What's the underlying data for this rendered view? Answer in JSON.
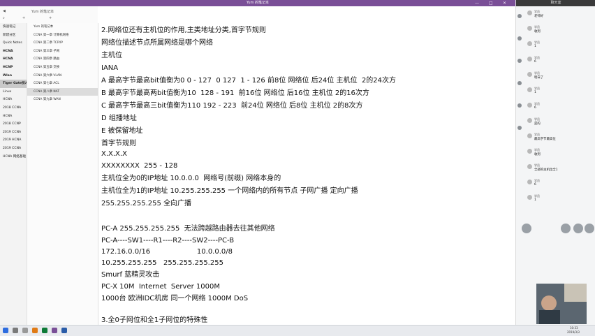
{
  "window": {
    "title": "Yum 的笔记本",
    "controls": [
      "—",
      "□",
      "✕"
    ]
  },
  "toolbar": {
    "notebook_label": "Yum 的笔记本",
    "add_section": "+",
    "add_page": "+"
  },
  "sidebar": {
    "sections": [
      {
        "label": "快速笔记"
      },
      {
        "label": "新建分区"
      },
      {
        "label": "Quick Notes"
      },
      {
        "label": "HCNA"
      },
      {
        "label": "HCNA"
      },
      {
        "label": "HCNP"
      },
      {
        "label": "Wlan"
      },
      {
        "label": "Tiger Gate技术讨论"
      },
      {
        "label": "Linux"
      },
      {
        "label": "HCNA"
      },
      {
        "label": "2018 CCNA"
      },
      {
        "label": "HCNA"
      },
      {
        "label": "2018 CCNP"
      },
      {
        "label": "2019 CCNA"
      },
      {
        "label": "2019 HCNA"
      },
      {
        "label": "2019 CCNA"
      },
      {
        "label": "HCNA 网络基础"
      }
    ],
    "selected_index": 7
  },
  "pages": {
    "items": [
      {
        "label": "Yum 的笔记本"
      },
      {
        "label": "CCNA 第一章 计算机网络"
      },
      {
        "label": "CCNA 第二章 TCP/IP"
      },
      {
        "label": "CCNA 第三章 子网"
      },
      {
        "label": "CCNA 第四章 路由"
      },
      {
        "label": "CCNA 第五章 交换"
      },
      {
        "label": "CCNA 第六章 VLAN"
      },
      {
        "label": "CCNA 第七章 ACL"
      },
      {
        "label": "CCNA 第八章 NAT"
      },
      {
        "label": "CCNA 第九章 WAN"
      }
    ],
    "selected_index": 8
  },
  "content": {
    "lines": [
      {
        "text": "2.网络位还有主机位的作用,主类地址分类,首字节规则"
      },
      {
        "text": "网络位描述节点所属网络是哪个网络"
      },
      {
        "text": "主机位"
      },
      {
        "text": "IANA"
      },
      {
        "text": "A 最高字节最高bit值衡为0 0 - 127  0 127  1 - 126 前8位 网络位 后24位 主机位  2的24次方"
      },
      {
        "text": "B 最高字节最高两bit值衡为10  128 - 191  前16位 网络位 后16位 主机位 2的16次方"
      },
      {
        "text": "C 最高字节最高三bit值衡为110 192 - 223  前24位 网络位 后8位 主机位 2的8次方"
      },
      {
        "text": "D 组播地址"
      },
      {
        "text": "E 被保留地址"
      },
      {
        "text": "首字节规则"
      },
      {
        "text": "X.X.X.X"
      },
      {
        "text": "XXXXXXXX  255 - 128"
      },
      {
        "text": "主机位全为0的IP地址 10.0.0.0  网络号(前缀) 网络本身的"
      },
      {
        "text": "主机位全为1的IP地址 10.255.255.255 一个网络内的所有节点 子网广播 定向广播"
      },
      {
        "text": "255.255.255.255 全向广播"
      },
      {
        "text": "PC-A 255.255.255.255  无法跨越路由器去往其他网络"
      },
      {
        "text": "PC-A----SW1----R1----R2----SW2----PC-B"
      },
      {
        "text": "172.16.0.0/16                     10.0.0.0/8"
      },
      {
        "text": "10.255.255.255   255.255.255.255"
      },
      {
        "text": "Smurf 蓝精灵攻击"
      },
      {
        "text": "PC-X 10M  Internet  Server 1000M"
      },
      {
        "text": "1000台 欧洲IDC机房 同一个网络 1000M DoS"
      },
      {
        "text": "3.全0子网位和全1子网位的特殊性"
      }
    ]
  },
  "right_panel": {
    "title": "聊天室",
    "messages": [
      {
        "name": "学员",
        "text": "老师好"
      },
      {
        "name": "学员",
        "text": "收到"
      },
      {
        "name": "学员",
        "text": "1"
      },
      {
        "name": "学员",
        "text": "6"
      },
      {
        "name": "学员",
        "text": "明白了"
      },
      {
        "name": "学员",
        "text": "1"
      },
      {
        "name": "学员",
        "text": "6"
      },
      {
        "name": "学员",
        "text": "是的"
      },
      {
        "name": "学员",
        "text": "最高字节最高位"
      },
      {
        "name": "学员",
        "text": "收到"
      },
      {
        "name": "学员",
        "text": "全部的主机位全1"
      },
      {
        "name": "学员",
        "text": "6"
      },
      {
        "name": "学员",
        "text": "1"
      }
    ]
  },
  "taskbar": {
    "time": "10:33",
    "date": "2019/3/3"
  },
  "colors": {
    "titlebar": "#7a4f97",
    "sidebar": "#f3f3f3",
    "taskbar": "#e8eaee"
  }
}
